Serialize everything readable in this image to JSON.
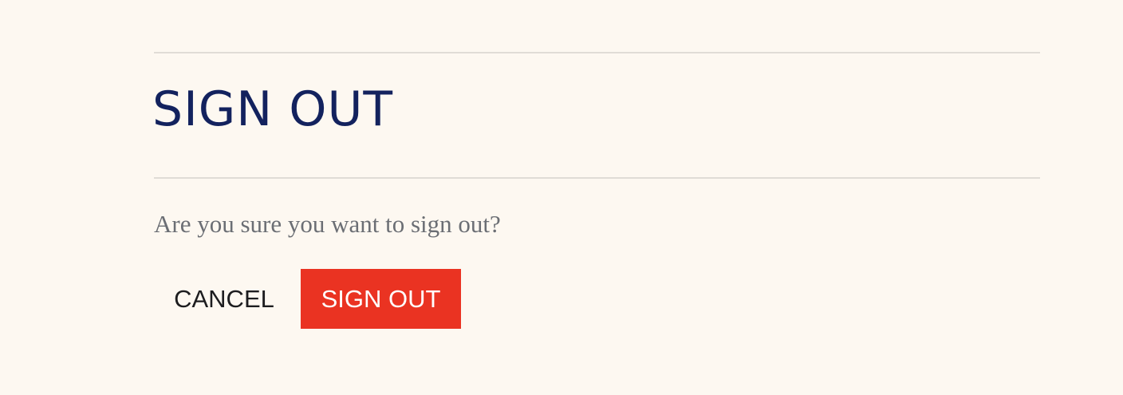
{
  "dialog": {
    "title": "SIGN OUT",
    "message": "Are you sure you want to sign out?",
    "cancel_label": "CANCEL",
    "confirm_label": "SIGN OUT"
  },
  "colors": {
    "background": "#fdf8f1",
    "title": "#13225e",
    "message": "#6b6e74",
    "confirm_button": "#ea3322",
    "divider": "#e0dcd6"
  }
}
